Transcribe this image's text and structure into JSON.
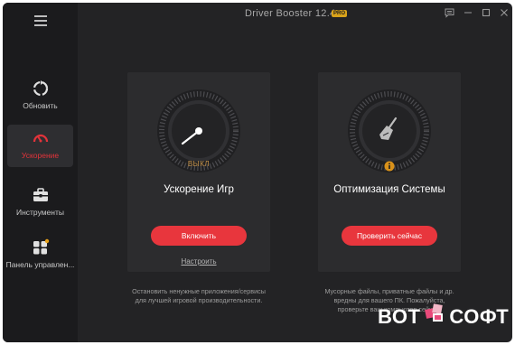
{
  "app": {
    "title": "Driver Booster 12.4",
    "badge": "PRO"
  },
  "sidebar": {
    "items": [
      {
        "label": "Обновить"
      },
      {
        "label": "Ускорение"
      },
      {
        "label": "Инструменты"
      },
      {
        "label": "Панель управлен..."
      }
    ]
  },
  "game_boost": {
    "status": "ВЫКЛ",
    "title": "Ускорение Игр",
    "button": "Включить",
    "link": "Настроить",
    "desc_line1": "Остановить ненужные приложения/сервисы",
    "desc_line2": "для лучшей игровой производительности."
  },
  "system_opt": {
    "title": "Оптимизация Системы",
    "button": "Проверить сейчас",
    "desc_line1": "Мусорные файлы, приватные файлы и др.",
    "desc_line2": "вредны для вашего ПК. Пожалуйста,",
    "desc_line3": "проверьте ваш компьютер сейчас."
  },
  "watermark": {
    "left": "ВОТ",
    "right": "СОФТ"
  },
  "colors": {
    "accent": "#e8363d",
    "background": "#232325",
    "sidebar": "#1b1b1d",
    "card": "#2c2c2e",
    "badge": "#d8a21a"
  },
  "icons": [
    "menu-icon",
    "refresh-icon",
    "speedometer-icon",
    "toolbox-icon",
    "apps-icon",
    "feedback-icon",
    "minimize-icon",
    "maximize-icon",
    "close-icon",
    "broom-icon",
    "info-icon"
  ]
}
